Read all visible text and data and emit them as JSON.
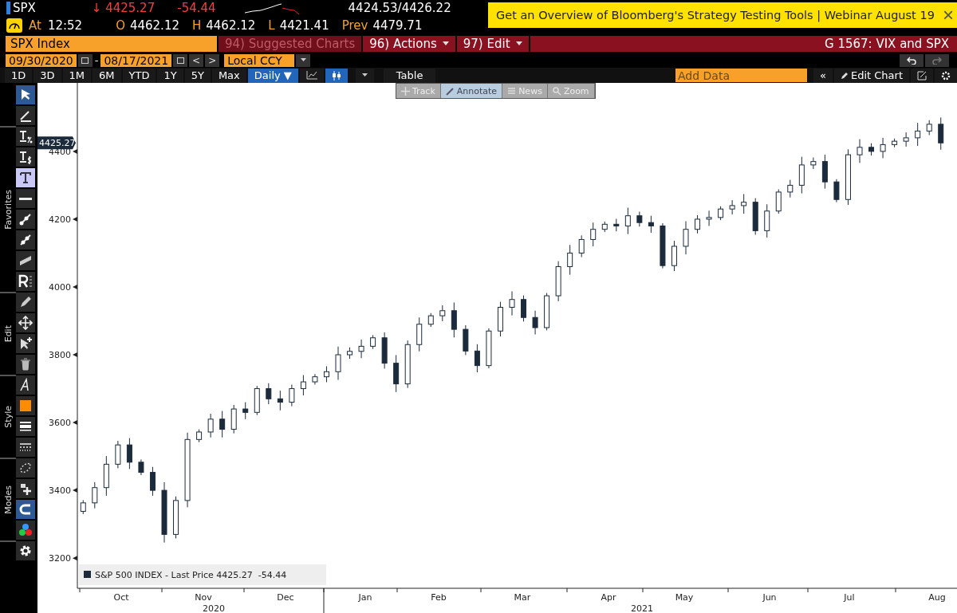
{
  "quote": {
    "ticker": "SPX",
    "last": "↓ 4425.27",
    "change": "-54.44",
    "bid": "4424.53",
    "ask": "/4426.22",
    "time_label": "At",
    "time": "12:52",
    "fields": [
      {
        "label": "O",
        "value": "4462.12"
      },
      {
        "label": "H",
        "value": "4462.12"
      },
      {
        "label": "L",
        "value": "4421.41"
      },
      {
        "label": "Prev",
        "value": "4479.71"
      }
    ]
  },
  "banner": {
    "text": "Get an Overview of Bloomberg's Strategy Testing Tools | Webinar August 19",
    "close": "×"
  },
  "command_bar": {
    "security": "SPX Index",
    "menus": [
      {
        "label": "94) Suggested Charts",
        "disabled": true,
        "caret": false
      },
      {
        "label": "96) Actions",
        "disabled": false,
        "caret": true
      },
      {
        "label": "97) Edit",
        "disabled": false,
        "caret": true
      }
    ],
    "title": "G 1567: VIX and SPX"
  },
  "date_bar": {
    "start": "09/30/2020",
    "separator": "-",
    "end": "08/17/2021",
    "prev": "<",
    "next": ">",
    "currency": "Local CCY"
  },
  "period_bar": {
    "periods": [
      {
        "label": "1D",
        "selected": false
      },
      {
        "label": "3D",
        "selected": false
      },
      {
        "label": "1M",
        "selected": false
      },
      {
        "label": "6M",
        "selected": false
      },
      {
        "label": "YTD",
        "selected": false
      },
      {
        "label": "1Y",
        "selected": false
      },
      {
        "label": "5Y",
        "selected": false
      },
      {
        "label": "Max",
        "selected": false
      }
    ],
    "frequency": "Daily ▼",
    "chart_types": [
      {
        "kind": "line",
        "selected": false
      },
      {
        "kind": "candle",
        "selected": true
      }
    ],
    "table": "Table",
    "add_data_placeholder": "Add Data",
    "collapse": "«",
    "edit_chart": "Edit Chart"
  },
  "overlay_tools": [
    {
      "label": "Track",
      "kind": "track",
      "selected": false
    },
    {
      "label": "Annotate",
      "kind": "annotate",
      "selected": true
    },
    {
      "label": "News",
      "kind": "news",
      "selected": false
    },
    {
      "label": "Zoom",
      "kind": "zoom",
      "selected": false
    }
  ],
  "toolbar": [
    {
      "tools": [
        {
          "kind": "pointer",
          "selected": true
        },
        {
          "kind": "pen-line",
          "selected": false
        }
      ]
    },
    {
      "label": "Favorites",
      "tools": [
        {
          "kind": "pct",
          "selected": false
        },
        {
          "kind": "usd",
          "selected": false
        },
        {
          "kind": "text",
          "selected": true
        },
        {
          "kind": "hline",
          "selected": false
        },
        {
          "kind": "segment",
          "selected": false
        },
        {
          "kind": "segment2",
          "selected": false
        },
        {
          "kind": "channel",
          "selected": false
        },
        {
          "kind": "rlist",
          "selected": false
        }
      ]
    },
    {
      "label": "Edit",
      "tools": [
        {
          "kind": "pencil",
          "selected": false
        },
        {
          "kind": "move",
          "selected": false
        },
        {
          "kind": "pointer-plus",
          "selected": false
        },
        {
          "kind": "trash",
          "selected": false
        }
      ]
    },
    {
      "label": "Style",
      "tools": [
        {
          "kind": "font",
          "selected": false
        },
        {
          "kind": "swatch",
          "selected": false
        },
        {
          "kind": "lines",
          "selected": false
        },
        {
          "kind": "dashes",
          "selected": false
        }
      ]
    },
    {
      "label": "Modes",
      "tools": [
        {
          "kind": "lasso",
          "selected": false
        },
        {
          "kind": "lock-plus",
          "selected": false
        },
        {
          "kind": "magnet",
          "selected": true
        },
        {
          "kind": "colors",
          "selected": false
        }
      ]
    },
    {
      "tools": [
        {
          "kind": "gear",
          "selected": false
        }
      ]
    }
  ],
  "chart": {
    "price_tag": "4425.27",
    "legend": {
      "label": "S&P 500 INDEX - Last Price 4425.27  -54.44",
      "color": "#1c2b3c"
    },
    "months": [
      "Oct",
      "Nov",
      "Dec",
      "Jan",
      "Feb",
      "Mar",
      "Apr",
      "May",
      "Jun",
      "Jul",
      "Aug"
    ],
    "years": [
      "2020",
      "2021"
    ],
    "chart_data": {
      "type": "candlestick",
      "ylim": [
        3111,
        4602
      ],
      "yticks": [
        3200,
        3400,
        3600,
        3800,
        4000,
        4200,
        4400
      ],
      "ohlc": [
        [
          3338,
          3371,
          3330,
          3363
        ],
        [
          3363,
          3424,
          3347,
          3408
        ],
        [
          3408,
          3501,
          3384,
          3477
        ],
        [
          3477,
          3546,
          3465,
          3534
        ],
        [
          3534,
          3554,
          3463,
          3483
        ],
        [
          3483,
          3491,
          3445,
          3453
        ],
        [
          3453,
          3469,
          3384,
          3400
        ],
        [
          3400,
          3424,
          3246,
          3270
        ],
        [
          3270,
          3382,
          3258,
          3370
        ],
        [
          3370,
          3570,
          3350,
          3550
        ],
        [
          3550,
          3580,
          3542,
          3572
        ],
        [
          3572,
          3626,
          3556,
          3610
        ],
        [
          3610,
          3634,
          3556,
          3580
        ],
        [
          3580,
          3652,
          3568,
          3640
        ],
        [
          3640,
          3660,
          3610,
          3630
        ],
        [
          3630,
          3708,
          3622,
          3700
        ],
        [
          3700,
          3716,
          3654,
          3670
        ],
        [
          3670,
          3694,
          3636,
          3660
        ],
        [
          3660,
          3712,
          3648,
          3700
        ],
        [
          3700,
          3740,
          3680,
          3720
        ],
        [
          3720,
          3743,
          3712,
          3735
        ],
        [
          3735,
          3766,
          3719,
          3750
        ],
        [
          3750,
          3824,
          3726,
          3800
        ],
        [
          3800,
          3822,
          3788,
          3810
        ],
        [
          3810,
          3845,
          3790,
          3825
        ],
        [
          3825,
          3858,
          3817,
          3850
        ],
        [
          3850,
          3866,
          3759,
          3775
        ],
        [
          3775,
          3799,
          3690,
          3714
        ],
        [
          3714,
          3842,
          3702,
          3830
        ],
        [
          3830,
          3910,
          3810,
          3890
        ],
        [
          3890,
          3923,
          3882,
          3915
        ],
        [
          3915,
          3946,
          3899,
          3930
        ],
        [
          3930,
          3954,
          3851,
          3875
        ],
        [
          3875,
          3887,
          3799,
          3811
        ],
        [
          3811,
          3831,
          3748,
          3768
        ],
        [
          3768,
          3878,
          3760,
          3870
        ],
        [
          3870,
          3956,
          3854,
          3940
        ],
        [
          3940,
          3987,
          3916,
          3963
        ],
        [
          3963,
          3975,
          3898,
          3910
        ],
        [
          3910,
          3930,
          3860,
          3880
        ],
        [
          3880,
          3982,
          3872,
          3974
        ],
        [
          3974,
          4076,
          3958,
          4060
        ],
        [
          4060,
          4124,
          4036,
          4100
        ],
        [
          4100,
          4152,
          4088,
          4140
        ],
        [
          4140,
          4190,
          4120,
          4170
        ],
        [
          4170,
          4193,
          4162,
          4185
        ],
        [
          4185,
          4201,
          4164,
          4180
        ],
        [
          4180,
          4234,
          4156,
          4210
        ],
        [
          4210,
          4222,
          4178,
          4190
        ],
        [
          4190,
          4210,
          4160,
          4180
        ],
        [
          4180,
          4188,
          4055,
          4063
        ],
        [
          4063,
          4136,
          4047,
          4120
        ],
        [
          4120,
          4194,
          4096,
          4170
        ],
        [
          4170,
          4212,
          4158,
          4200
        ],
        [
          4200,
          4225,
          4180,
          4205
        ],
        [
          4205,
          4238,
          4197,
          4230
        ],
        [
          4230,
          4256,
          4214,
          4240
        ],
        [
          4240,
          4274,
          4216,
          4250
        ],
        [
          4250,
          4262,
          4154,
          4166
        ],
        [
          4166,
          4244,
          4146,
          4224
        ],
        [
          4224,
          4288,
          4216,
          4280
        ],
        [
          4280,
          4316,
          4264,
          4300
        ],
        [
          4300,
          4384,
          4276,
          4360
        ],
        [
          4360,
          4382,
          4348,
          4370
        ],
        [
          4370,
          4390,
          4290,
          4310
        ],
        [
          4310,
          4318,
          4250,
          4258
        ],
        [
          4258,
          4406,
          4242,
          4390
        ],
        [
          4390,
          4436,
          4366,
          4412
        ],
        [
          4412,
          4424,
          4388,
          4400
        ],
        [
          4400,
          4440,
          4380,
          4420
        ],
        [
          4420,
          4438,
          4412,
          4430
        ],
        [
          4430,
          4456,
          4414,
          4440
        ],
        [
          4440,
          4484,
          4416,
          4460
        ],
        [
          4460,
          4492,
          4448,
          4480
        ],
        [
          4480,
          4500,
          4405,
          4425
        ]
      ]
    }
  }
}
